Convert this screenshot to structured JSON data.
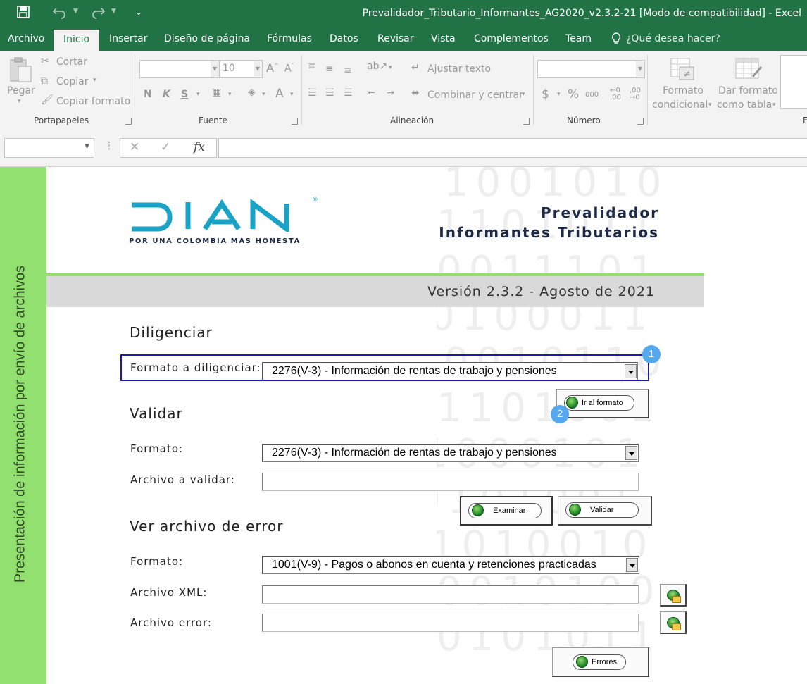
{
  "window": {
    "title": "Prevalidador_Tributario_Informantes_AG2020_v2.3.2-21  [Modo de compatibilidad] - Excel"
  },
  "ribbon_tabs": {
    "archivo": "Archivo",
    "inicio": "Inicio",
    "insertar": "Insertar",
    "diseno": "Diseño de página",
    "formulas": "Fórmulas",
    "datos": "Datos",
    "revisar": "Revisar",
    "vista": "Vista",
    "complementos": "Complementos",
    "team": "Team",
    "search": "¿Qué desea hacer?"
  },
  "ribbon": {
    "pegar": "Pegar",
    "cortar": "Cortar",
    "copiar": "Copiar",
    "copiar_formato": "Copiar formato",
    "portapapeles": "Portapapeles",
    "font_size": "10",
    "bold": "N",
    "italic": "K",
    "underline": "S",
    "fuente": "Fuente",
    "ajustar_texto": "Ajustar texto",
    "combinar": "Combinar y centrar",
    "alineacion": "Alineación",
    "currency": "$",
    "percent": "%",
    "thousands": "000",
    "numero": "Número",
    "formato_condicional_1": "Formato",
    "formato_condicional_2": "condicional",
    "dar_formato_1": "Dar formato",
    "dar_formato_2": "como tabla",
    "estilos_partial": "E"
  },
  "formula_bar": {
    "fx": "fx",
    "name_box": "",
    "formula": ""
  },
  "sheet": {
    "sidebar_text": "Presentación de información por envío de archivos",
    "logo_main": "DIAN",
    "logo_tagline": "POR UNA COLOMBIA MÁS HONESTA",
    "logo_reg": "®",
    "title_line1": "Prevalidador",
    "title_line2": "Informantes Tributarios",
    "version": "Versión 2.3.2 - Agosto de 2021",
    "bg_row1": "1001010",
    "bg_row2": "1101011",
    "bg_row3": "0011101",
    "bg_row4": "0100011",
    "bg_row5": "0010110",
    "bg_row6": "1101001",
    "bg_row7": "1000101",
    "bg_row8": "0101001",
    "bg_row9": "1010010",
    "bg_row10": "0010100",
    "bg_row11": "0101011"
  },
  "diligenciar": {
    "heading": "Diligenciar",
    "label": "Formato a diligenciar:",
    "value": "2276(V-3) - Información de rentas de trabajo y pensiones",
    "button": "Ir al formato",
    "marker1": "1",
    "marker2": "2"
  },
  "validar": {
    "heading": "Validar",
    "formato_label": "Formato:",
    "formato_value": "2276(V-3) - Información de rentas de trabajo y pensiones",
    "archivo_label": "Archivo a validar:",
    "archivo_value": "",
    "examinar": "Examinar",
    "validar_btn": "Validar"
  },
  "errores": {
    "heading": "Ver archivo de error",
    "formato_label": "Formato:",
    "formato_value": "1001(V-9) - Pagos o abonos en cuenta y retenciones practicadas",
    "xml_label": "Archivo XML:",
    "xml_value": "",
    "error_label": "Archivo error:",
    "error_value": "",
    "errores_btn": "Errores"
  },
  "colors": {
    "excel_green": "#217346",
    "sidebar_green": "#92e070",
    "dian_teal": "#1aa3c6",
    "highlight_blue": "#1a1aa8",
    "marker_blue": "#55a7ee"
  }
}
